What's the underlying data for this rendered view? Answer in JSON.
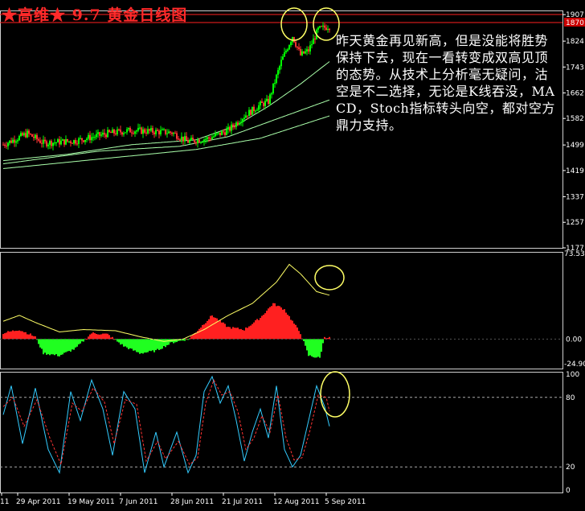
{
  "title": "★高维★ 9.7 黄金日线图",
  "annotation": "昨天黄金再见新高，但是没能将胜势保持下去，现在一看转变成双高见顶的态势。从技术上分析毫无疑问，沽空是不二选择，无论是K线吞没，MACD，Stoch指标转头向空，都对空方鼎力支持。",
  "chart_data": [
    {
      "type": "candlestick",
      "panel": "price",
      "y_tick_labels": [
        "1907",
        "1824",
        "1743",
        "1662",
        "1582",
        "1499",
        "1419",
        "1337",
        "1257",
        "1177"
      ],
      "last_price_marker": "1870",
      "x_tick_labels": [
        "11",
        "29 Apr 2011",
        "19 May 2011",
        "7 Jun 2011",
        "28 Jun 2011",
        "21 Jul 2011",
        "12 Aug 2011",
        "5 Sep 2011"
      ],
      "close_anchors": [
        [
          0,
          1500
        ],
        [
          15,
          1535
        ],
        [
          25,
          1505
        ],
        [
          45,
          1512
        ],
        [
          65,
          1535
        ],
        [
          80,
          1545
        ],
        [
          105,
          1538
        ],
        [
          115,
          1510
        ],
        [
          128,
          1520
        ],
        [
          140,
          1545
        ],
        [
          150,
          1590
        ],
        [
          160,
          1625
        ],
        [
          165,
          1635
        ],
        [
          173,
          1760
        ],
        [
          180,
          1840
        ],
        [
          185,
          1780
        ],
        [
          190,
          1795
        ],
        [
          196,
          1860
        ],
        [
          202,
          1870
        ]
      ],
      "moving_averages": [
        {
          "anchors": [
            [
              0,
              1450
            ],
            [
              40,
              1470
            ],
            [
              80,
              1500
            ],
            [
              120,
              1515
            ],
            [
              145,
              1560
            ],
            [
              165,
              1620
            ],
            [
              185,
              1690
            ],
            [
              203,
              1760
            ]
          ],
          "color": "#aaffaa"
        },
        {
          "anchors": [
            [
              0,
              1440
            ],
            [
              60,
              1480
            ],
            [
              110,
              1495
            ],
            [
              140,
              1525
            ],
            [
              170,
              1580
            ],
            [
              203,
              1640
            ]
          ],
          "color": "#aaffaa"
        },
        {
          "anchors": [
            [
              0,
              1425
            ],
            [
              70,
              1460
            ],
            [
              120,
              1485
            ],
            [
              160,
              1520
            ],
            [
              203,
              1590
            ]
          ],
          "color": "#aaffaa"
        }
      ],
      "colors": {
        "up": "#00ff00",
        "down": "#ff3333"
      },
      "ylim": [
        1177,
        1920
      ],
      "circled_peaks": [
        181,
        201
      ]
    },
    {
      "type": "macd",
      "panel": "macd",
      "y_tick_labels": [
        "73.53",
        "0.00",
        "-24.90"
      ],
      "ylim": [
        -24.9,
        73.53
      ],
      "histogram_anchors": [
        [
          0,
          5
        ],
        [
          10,
          8
        ],
        [
          20,
          2
        ],
        [
          25,
          -12
        ],
        [
          35,
          -14
        ],
        [
          45,
          -8
        ],
        [
          55,
          5
        ],
        [
          65,
          4
        ],
        [
          75,
          -6
        ],
        [
          85,
          -12
        ],
        [
          95,
          -10
        ],
        [
          105,
          -3
        ],
        [
          115,
          0
        ],
        [
          120,
          6
        ],
        [
          130,
          20
        ],
        [
          140,
          10
        ],
        [
          150,
          8
        ],
        [
          160,
          18
        ],
        [
          168,
          30
        ],
        [
          175,
          25
        ],
        [
          185,
          5
        ],
        [
          190,
          -14
        ],
        [
          197,
          -16
        ],
        [
          200,
          2
        ],
        [
          203,
          1
        ]
      ],
      "signal_anchors": [
        [
          0,
          15
        ],
        [
          10,
          20
        ],
        [
          20,
          14
        ],
        [
          35,
          6
        ],
        [
          50,
          8
        ],
        [
          70,
          7
        ],
        [
          85,
          2
        ],
        [
          100,
          -2
        ],
        [
          112,
          0
        ],
        [
          125,
          8
        ],
        [
          140,
          20
        ],
        [
          155,
          30
        ],
        [
          170,
          48
        ],
        [
          178,
          63
        ],
        [
          185,
          55
        ],
        [
          195,
          40
        ],
        [
          203,
          37
        ]
      ],
      "signal_color": "#ffff66",
      "colors": {
        "positive": "#ff2020",
        "negative": "#20ff20"
      }
    },
    {
      "type": "stochastic",
      "panel": "stoch",
      "y_tick_labels": [
        "100",
        "80",
        "20",
        "0"
      ],
      "ylim": [
        0,
        100
      ],
      "levels": [
        80,
        20
      ],
      "k_anchors": [
        [
          0,
          65
        ],
        [
          5,
          90
        ],
        [
          12,
          40
        ],
        [
          20,
          88
        ],
        [
          28,
          35
        ],
        [
          35,
          15
        ],
        [
          42,
          85
        ],
        [
          48,
          60
        ],
        [
          55,
          95
        ],
        [
          62,
          70
        ],
        [
          68,
          30
        ],
        [
          75,
          85
        ],
        [
          82,
          70
        ],
        [
          88,
          15
        ],
        [
          95,
          50
        ],
        [
          100,
          20
        ],
        [
          108,
          50
        ],
        [
          115,
          15
        ],
        [
          120,
          30
        ],
        [
          125,
          85
        ],
        [
          130,
          98
        ],
        [
          135,
          75
        ],
        [
          140,
          90
        ],
        [
          145,
          60
        ],
        [
          150,
          25
        ],
        [
          155,
          50
        ],
        [
          160,
          70
        ],
        [
          165,
          45
        ],
        [
          170,
          90
        ],
        [
          175,
          35
        ],
        [
          180,
          20
        ],
        [
          185,
          30
        ],
        [
          190,
          60
        ],
        [
          195,
          90
        ],
        [
          200,
          72
        ],
        [
          203,
          55
        ]
      ],
      "d_anchors": [
        [
          0,
          72
        ],
        [
          6,
          80
        ],
        [
          13,
          55
        ],
        [
          21,
          78
        ],
        [
          29,
          45
        ],
        [
          36,
          22
        ],
        [
          43,
          75
        ],
        [
          49,
          68
        ],
        [
          56,
          88
        ],
        [
          63,
          76
        ],
        [
          69,
          40
        ],
        [
          76,
          78
        ],
        [
          83,
          74
        ],
        [
          89,
          25
        ],
        [
          96,
          42
        ],
        [
          101,
          27
        ],
        [
          109,
          42
        ],
        [
          116,
          22
        ],
        [
          121,
          28
        ],
        [
          126,
          75
        ],
        [
          131,
          95
        ],
        [
          136,
          82
        ],
        [
          141,
          85
        ],
        [
          146,
          68
        ],
        [
          151,
          35
        ],
        [
          156,
          45
        ],
        [
          161,
          64
        ],
        [
          166,
          50
        ],
        [
          171,
          82
        ],
        [
          176,
          45
        ],
        [
          181,
          26
        ],
        [
          186,
          28
        ],
        [
          191,
          52
        ],
        [
          196,
          82
        ],
        [
          201,
          80
        ],
        [
          203,
          68
        ]
      ],
      "k_color": "#33ccff",
      "d_color": "#ff3333"
    }
  ]
}
